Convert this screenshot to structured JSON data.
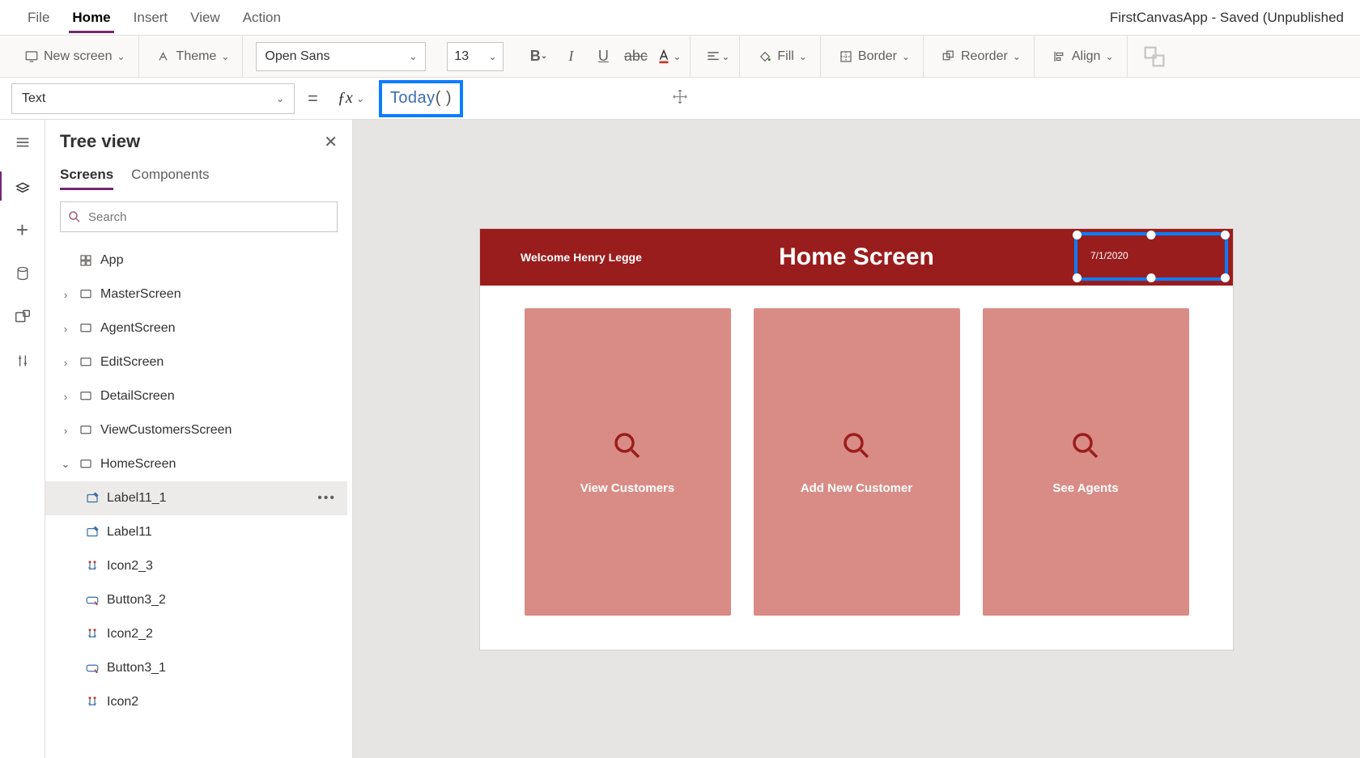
{
  "app_title": "FirstCanvasApp - Saved (Unpublished",
  "menu": {
    "file": "File",
    "home": "Home",
    "insert": "Insert",
    "view": "View",
    "action": "Action"
  },
  "ribbon": {
    "new_screen": "New screen",
    "theme": "Theme",
    "font_family": "Open Sans",
    "font_size": "13",
    "fill": "Fill",
    "border": "Border",
    "reorder": "Reorder",
    "align": "Align"
  },
  "formula_bar": {
    "property": "Text",
    "formula_fn": "Today",
    "formula_parens": "( )"
  },
  "tree": {
    "title": "Tree view",
    "tabs": {
      "screens": "Screens",
      "components": "Components"
    },
    "search_placeholder": "Search",
    "app_node": "App",
    "screens": [
      {
        "name": "MasterScreen",
        "expanded": false
      },
      {
        "name": "AgentScreen",
        "expanded": false
      },
      {
        "name": "EditScreen",
        "expanded": false
      },
      {
        "name": "DetailScreen",
        "expanded": false
      },
      {
        "name": "ViewCustomersScreen",
        "expanded": false
      },
      {
        "name": "HomeScreen",
        "expanded": true
      }
    ],
    "home_children": [
      {
        "name": "Label11_1",
        "type": "label",
        "selected": true
      },
      {
        "name": "Label11",
        "type": "label"
      },
      {
        "name": "Icon2_3",
        "type": "icon"
      },
      {
        "name": "Button3_2",
        "type": "button"
      },
      {
        "name": "Icon2_2",
        "type": "icon"
      },
      {
        "name": "Button3_1",
        "type": "button"
      },
      {
        "name": "Icon2",
        "type": "icon"
      }
    ]
  },
  "canvas": {
    "welcome": "Welcome Henry Legge",
    "header_title": "Home Screen",
    "date": "7/1/2020",
    "cards": [
      {
        "label": "View Customers"
      },
      {
        "label": "Add New Customer"
      },
      {
        "label": "See Agents"
      }
    ]
  }
}
